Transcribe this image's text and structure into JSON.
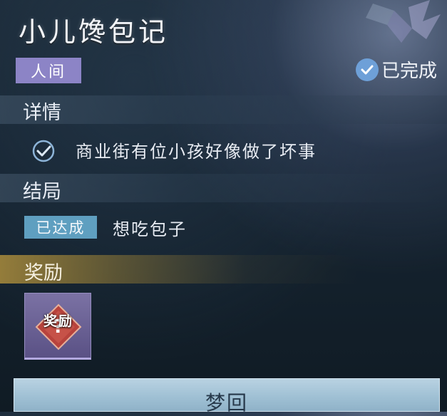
{
  "quest": {
    "title": "小儿馋包记",
    "world_tag": "人间",
    "status_label": "已完成"
  },
  "details": {
    "heading": "详情",
    "items": [
      {
        "text": "商业街有位小孩好像做了坏事",
        "icon": "checkmark-circle-icon"
      }
    ]
  },
  "ending": {
    "heading": "结局",
    "tag": "已达成",
    "text": "想吃包子"
  },
  "reward": {
    "heading": "奖励",
    "item_label": "奖励",
    "item_icon": "mystery-reward-icon"
  },
  "action": {
    "button_label": "梦回"
  },
  "colors": {
    "world_tag_bg": "#8c84c6",
    "ending_tag_bg": "#5f9fc0",
    "reward_bar": "#aa8c3c",
    "button_bg": "#a9c6d8"
  }
}
